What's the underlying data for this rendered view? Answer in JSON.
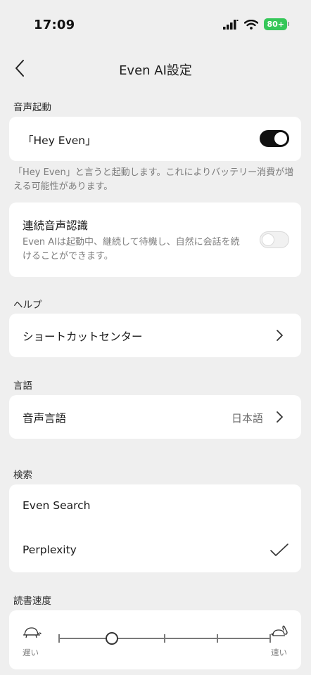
{
  "status_bar": {
    "time": "17:09",
    "battery": "80+"
  },
  "nav": {
    "title": "Even AI設定",
    "back_icon": "chevron-left-icon"
  },
  "voice_activation": {
    "section_label": "音声起動",
    "hey_even": {
      "label": "「Hey Even」",
      "enabled": true
    },
    "note": "「Hey Even」と言うと起動します。これによりバッテリー消費が増える可能性があります。"
  },
  "continuous_voice": {
    "label": "連続音声認識",
    "description": "Even AIは起動中、継続して待機し、自然に会話を続けることができます。",
    "enabled": false
  },
  "help": {
    "section_label": "ヘルプ",
    "shortcut_center": "ショートカットセンター"
  },
  "language": {
    "section_label": "言語",
    "voice_language_label": "音声言語",
    "voice_language_value": "日本語"
  },
  "search": {
    "section_label": "検索",
    "options": [
      {
        "label": "Even Search",
        "selected": false
      },
      {
        "label": "Perplexity",
        "selected": true
      }
    ]
  },
  "reading_speed": {
    "section_label": "読書速度",
    "slow_label": "遅い",
    "fast_label": "速い",
    "steps": 5,
    "value_index": 1
  }
}
